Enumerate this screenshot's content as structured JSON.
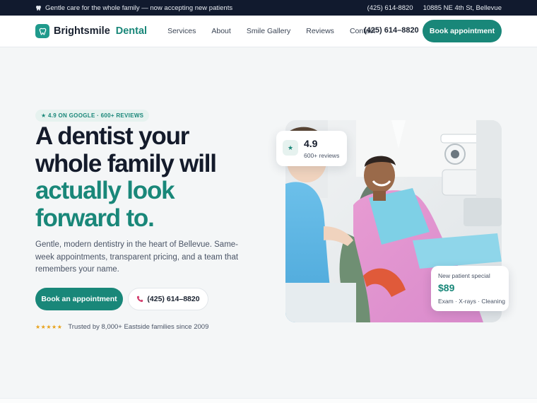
{
  "topbar": {
    "tagline": "Gentle care for the whole family — now accepting new patients",
    "phone": "(425) 614-8820",
    "address": "10885 NE 4th St, Bellevue",
    "icon": "tooth-icon"
  },
  "nav": {
    "brand": "Brightsmile",
    "brand_accent": "Dental",
    "links": [
      "Services",
      "About",
      "Smile Gallery",
      "Reviews",
      "Contact"
    ],
    "phone": "(425) 614–8820",
    "cta": "Book appointment"
  },
  "hero": {
    "badge": "★ 4.9 ON GOOGLE · 600+ REVIEWS",
    "headline_line1": "A dentist your",
    "headline_line2": "whole family will",
    "headline_accent1": "actually look",
    "headline_accent2": "forward to.",
    "lede": "Gentle, modern dentistry in the heart of Bellevue. Same-week appointments, transparent pricing, and a team that remembers your name.",
    "primary_cta": "Book an appointment",
    "secondary_cta": "(425) 614–8820",
    "stars": "★★★★★",
    "trust": "Trusted by 8,000+ Eastside families since 2009"
  },
  "rating_card": {
    "icon": "★",
    "value": "4.9",
    "sub": "600+ reviews"
  },
  "special_card": {
    "label": "New patient special",
    "price": "$89",
    "items": "Exam · X-rays · Cleaning"
  },
  "colors": {
    "accent": "#198779",
    "dark": "#111a2e",
    "star": "#e8a21b"
  }
}
